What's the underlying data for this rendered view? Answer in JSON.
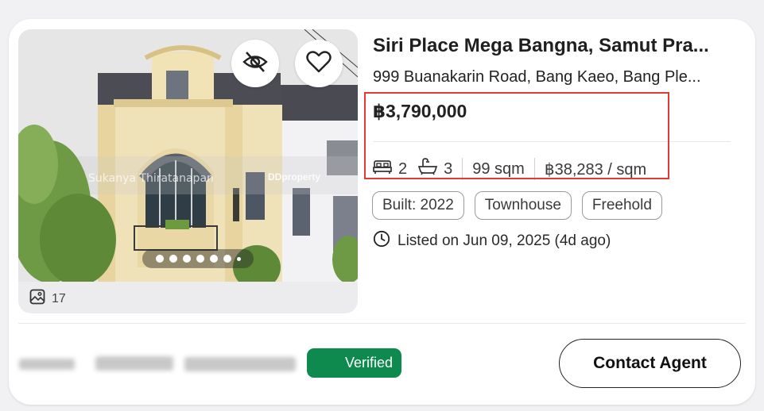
{
  "listing": {
    "title": "Siri Place Mega Bangna, Samut Pra...",
    "address": "999 Buanakarin Road, Bang Kaeo, Bang Ple...",
    "price": "฿3,790,000",
    "bedrooms": "2",
    "bathrooms": "3",
    "area": "99 sqm",
    "price_per_sqm": "฿38,283 / sqm",
    "tags": [
      "Built: 2022",
      "Townhouse",
      "Freehold"
    ],
    "listed": "Listed on Jun 09, 2025 (4d ago)"
  },
  "photo": {
    "count": "17",
    "watermark_author": "Sukanya Thiratanapan",
    "watermark_brand": "DDproperty",
    "carousel_dots": 7,
    "active_dot": 0
  },
  "agent": {
    "verified_label": "Verified",
    "contact_label": "Contact Agent"
  },
  "colors": {
    "verified_bg": "#0f8a4f",
    "highlight_border": "#e53935",
    "card_bg": "#ffffff"
  },
  "icons": [
    "hide-eye-icon",
    "heart-icon",
    "image-gallery-icon",
    "bed-icon",
    "bathtub-icon",
    "clock-icon"
  ]
}
